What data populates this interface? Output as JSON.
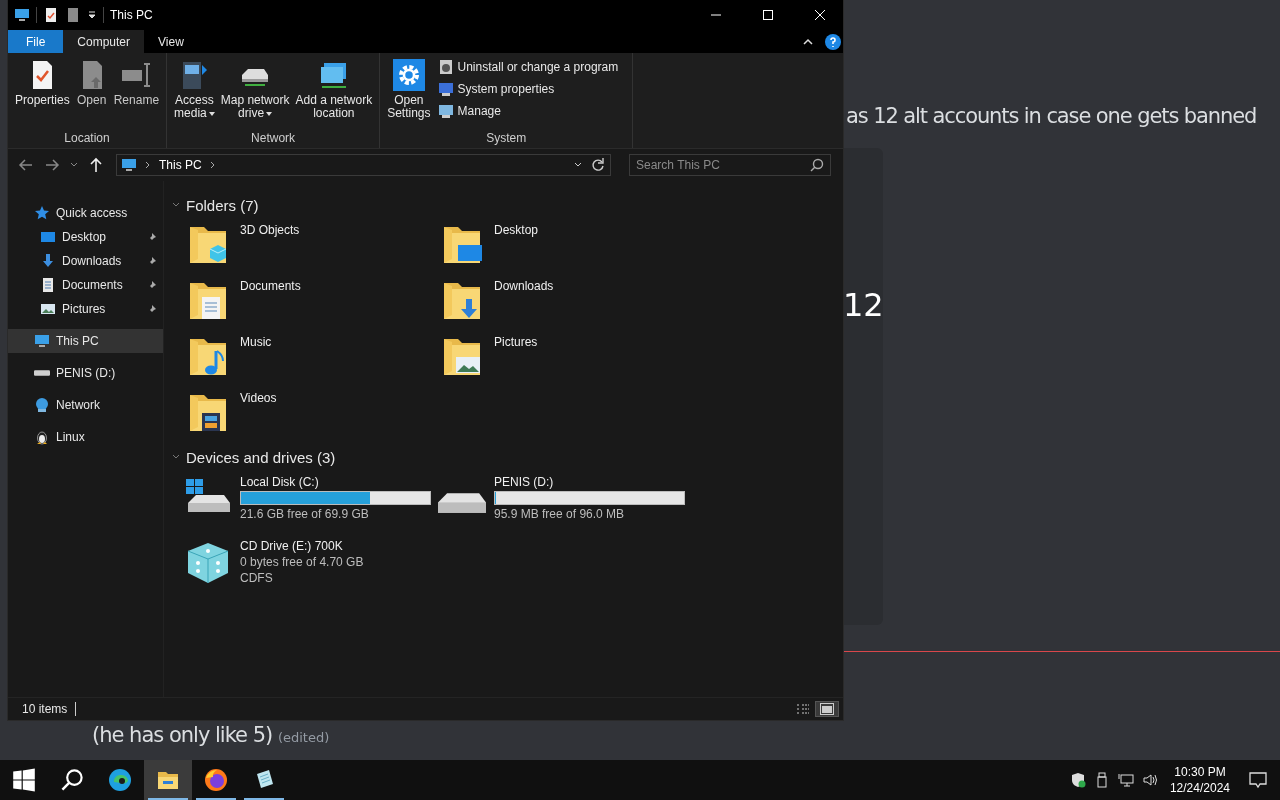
{
  "chat": {
    "message": "as 12 alt accounts in case one gets banned",
    "embed_text": "12",
    "reply": {
      "text": "(he has only like 5)",
      "edited": "(edited)"
    }
  },
  "window": {
    "title": "This PC"
  },
  "ribbon": {
    "tabs": [
      {
        "label": "File",
        "kind": "file",
        "selected": false
      },
      {
        "label": "Computer",
        "kind": "tab",
        "selected": true
      },
      {
        "label": "View",
        "kind": "tab",
        "selected": false
      }
    ],
    "groups": [
      {
        "label": "Location",
        "buttons": [
          {
            "lines": [
              "Properties"
            ],
            "disabled": false,
            "dropdown": false
          },
          {
            "lines": [
              "Open"
            ],
            "disabled": true,
            "dropdown": false
          },
          {
            "lines": [
              "Rename"
            ],
            "disabled": true,
            "dropdown": false
          }
        ]
      },
      {
        "label": "Network",
        "buttons": [
          {
            "lines": [
              "Access",
              "media"
            ],
            "disabled": false,
            "dropdown": true
          },
          {
            "lines": [
              "Map network",
              "drive"
            ],
            "disabled": false,
            "dropdown": true
          },
          {
            "lines": [
              "Add a network",
              "location"
            ],
            "disabled": false,
            "dropdown": false
          }
        ]
      },
      {
        "label": "System",
        "buttons": [
          {
            "lines": [
              "Open",
              "Settings"
            ],
            "disabled": false,
            "dropdown": false
          }
        ],
        "small": [
          "Uninstall or change a program",
          "System properties",
          "Manage"
        ]
      }
    ]
  },
  "address": {
    "path": [
      "This PC"
    ],
    "search_placeholder": "Search This PC"
  },
  "sidebar": {
    "items": [
      {
        "label": "Quick access",
        "selected": false,
        "children": [
          {
            "label": "Desktop",
            "pinned": true
          },
          {
            "label": "Downloads",
            "pinned": true
          },
          {
            "label": "Documents",
            "pinned": true
          },
          {
            "label": "Pictures",
            "pinned": true
          }
        ]
      },
      {
        "label": "This PC",
        "selected": true
      },
      {
        "label": "PENIS (D:)",
        "selected": false
      },
      {
        "label": "Network",
        "selected": false
      },
      {
        "label": "Linux",
        "selected": false
      }
    ]
  },
  "sections": [
    {
      "title": "Folders (7)",
      "expanded": true,
      "kind": "folders",
      "items": [
        {
          "name": "3D Objects"
        },
        {
          "name": "Desktop"
        },
        {
          "name": "Documents"
        },
        {
          "name": "Downloads"
        },
        {
          "name": "Music"
        },
        {
          "name": "Pictures"
        },
        {
          "name": "Videos"
        }
      ]
    },
    {
      "title": "Devices and drives (3)",
      "expanded": true,
      "kind": "drives",
      "items": [
        {
          "kind": "disk",
          "name": "Local Disk (C:)",
          "level": 0.68,
          "lines": [
            "21.6 GB free of 69.9 GB"
          ]
        },
        {
          "kind": "disk",
          "name": "PENIS (D:)",
          "level": 0.001,
          "lines": [
            "95.9 MB free of 96.0 MB"
          ]
        },
        {
          "kind": "cd",
          "name": "CD Drive (E:) 700K",
          "lines": [
            "0 bytes free of 4.70 GB",
            "CDFS"
          ]
        }
      ]
    }
  ],
  "status": {
    "text": "10 items",
    "views": [
      {
        "selected": false
      },
      {
        "selected": true
      }
    ]
  },
  "taskbar": {
    "apps": [
      {
        "selected": false,
        "running": false
      },
      {
        "selected": true,
        "running": true
      },
      {
        "selected": false,
        "running": true
      },
      {
        "selected": false,
        "running": true
      }
    ],
    "time": "10:30 PM",
    "date": "12/24/2024"
  }
}
